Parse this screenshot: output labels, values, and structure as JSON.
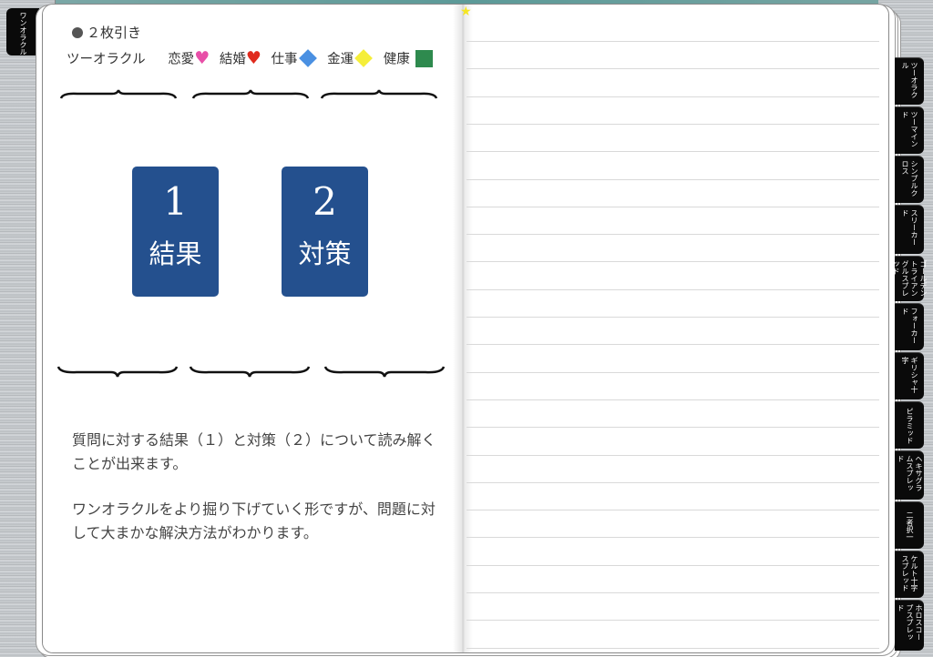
{
  "left_tab": "ワンオラクル",
  "heading": "２枚引き",
  "legend": {
    "title": "ツーオラクル",
    "love": "恋愛",
    "marriage": "結婚",
    "work": "仕事",
    "money": "金運",
    "health": "健康",
    "love_icon": "♥",
    "marriage_icon": "♥"
  },
  "colors": {
    "love": "#e84fa8",
    "marriage": "#e02a1d",
    "work": "#4a90e2",
    "money": "#f5ee3a",
    "health": "#2e8a4e",
    "card": "#24508e",
    "star": "#f5e623"
  },
  "cards": [
    {
      "number": "1",
      "label": "結果"
    },
    {
      "number": "2",
      "label": "対策"
    }
  ],
  "description": [
    "質問に対する結果（１）と対策（２）について読み解くことが出来ます。",
    "ワンオラクルをより掘り下げていく形ですが、問題に対して大まかな解決方法がわかります。"
  ],
  "star": "★",
  "tabs": [
    "ツーオラクル",
    "ツーマインド",
    "シンプルクロス",
    "スリーカード",
    "ゴールデントライアングルスプレッド",
    "フォーカード",
    "ギリシャ十字",
    "ピラミッド",
    "ヘキサグラムスプレッド",
    "二者択一",
    "ケルト十字スプレッド",
    "ホロスコープスプレッド"
  ]
}
